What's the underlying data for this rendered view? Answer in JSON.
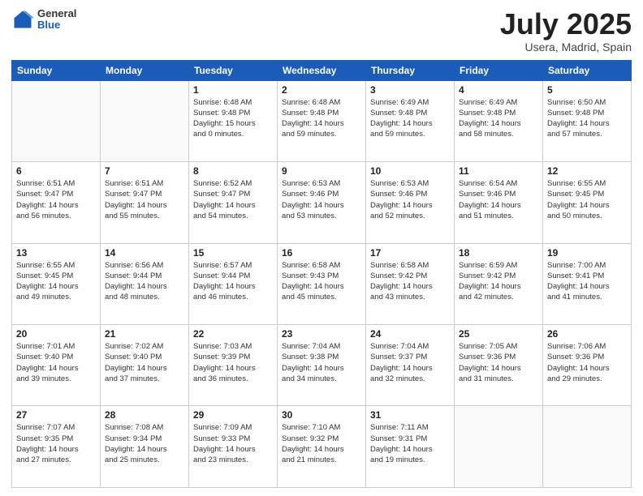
{
  "header": {
    "logo_general": "General",
    "logo_blue": "Blue",
    "month": "July 2025",
    "location": "Usera, Madrid, Spain"
  },
  "weekdays": [
    "Sunday",
    "Monday",
    "Tuesday",
    "Wednesday",
    "Thursday",
    "Friday",
    "Saturday"
  ],
  "weeks": [
    [
      {
        "day": "",
        "info": ""
      },
      {
        "day": "",
        "info": ""
      },
      {
        "day": "1",
        "info": "Sunrise: 6:48 AM\nSunset: 9:48 PM\nDaylight: 15 hours\nand 0 minutes."
      },
      {
        "day": "2",
        "info": "Sunrise: 6:48 AM\nSunset: 9:48 PM\nDaylight: 14 hours\nand 59 minutes."
      },
      {
        "day": "3",
        "info": "Sunrise: 6:49 AM\nSunset: 9:48 PM\nDaylight: 14 hours\nand 59 minutes."
      },
      {
        "day": "4",
        "info": "Sunrise: 6:49 AM\nSunset: 9:48 PM\nDaylight: 14 hours\nand 58 minutes."
      },
      {
        "day": "5",
        "info": "Sunrise: 6:50 AM\nSunset: 9:48 PM\nDaylight: 14 hours\nand 57 minutes."
      }
    ],
    [
      {
        "day": "6",
        "info": "Sunrise: 6:51 AM\nSunset: 9:47 PM\nDaylight: 14 hours\nand 56 minutes."
      },
      {
        "day": "7",
        "info": "Sunrise: 6:51 AM\nSunset: 9:47 PM\nDaylight: 14 hours\nand 55 minutes."
      },
      {
        "day": "8",
        "info": "Sunrise: 6:52 AM\nSunset: 9:47 PM\nDaylight: 14 hours\nand 54 minutes."
      },
      {
        "day": "9",
        "info": "Sunrise: 6:53 AM\nSunset: 9:46 PM\nDaylight: 14 hours\nand 53 minutes."
      },
      {
        "day": "10",
        "info": "Sunrise: 6:53 AM\nSunset: 9:46 PM\nDaylight: 14 hours\nand 52 minutes."
      },
      {
        "day": "11",
        "info": "Sunrise: 6:54 AM\nSunset: 9:46 PM\nDaylight: 14 hours\nand 51 minutes."
      },
      {
        "day": "12",
        "info": "Sunrise: 6:55 AM\nSunset: 9:45 PM\nDaylight: 14 hours\nand 50 minutes."
      }
    ],
    [
      {
        "day": "13",
        "info": "Sunrise: 6:55 AM\nSunset: 9:45 PM\nDaylight: 14 hours\nand 49 minutes."
      },
      {
        "day": "14",
        "info": "Sunrise: 6:56 AM\nSunset: 9:44 PM\nDaylight: 14 hours\nand 48 minutes."
      },
      {
        "day": "15",
        "info": "Sunrise: 6:57 AM\nSunset: 9:44 PM\nDaylight: 14 hours\nand 46 minutes."
      },
      {
        "day": "16",
        "info": "Sunrise: 6:58 AM\nSunset: 9:43 PM\nDaylight: 14 hours\nand 45 minutes."
      },
      {
        "day": "17",
        "info": "Sunrise: 6:58 AM\nSunset: 9:42 PM\nDaylight: 14 hours\nand 43 minutes."
      },
      {
        "day": "18",
        "info": "Sunrise: 6:59 AM\nSunset: 9:42 PM\nDaylight: 14 hours\nand 42 minutes."
      },
      {
        "day": "19",
        "info": "Sunrise: 7:00 AM\nSunset: 9:41 PM\nDaylight: 14 hours\nand 41 minutes."
      }
    ],
    [
      {
        "day": "20",
        "info": "Sunrise: 7:01 AM\nSunset: 9:40 PM\nDaylight: 14 hours\nand 39 minutes."
      },
      {
        "day": "21",
        "info": "Sunrise: 7:02 AM\nSunset: 9:40 PM\nDaylight: 14 hours\nand 37 minutes."
      },
      {
        "day": "22",
        "info": "Sunrise: 7:03 AM\nSunset: 9:39 PM\nDaylight: 14 hours\nand 36 minutes."
      },
      {
        "day": "23",
        "info": "Sunrise: 7:04 AM\nSunset: 9:38 PM\nDaylight: 14 hours\nand 34 minutes."
      },
      {
        "day": "24",
        "info": "Sunrise: 7:04 AM\nSunset: 9:37 PM\nDaylight: 14 hours\nand 32 minutes."
      },
      {
        "day": "25",
        "info": "Sunrise: 7:05 AM\nSunset: 9:36 PM\nDaylight: 14 hours\nand 31 minutes."
      },
      {
        "day": "26",
        "info": "Sunrise: 7:06 AM\nSunset: 9:36 PM\nDaylight: 14 hours\nand 29 minutes."
      }
    ],
    [
      {
        "day": "27",
        "info": "Sunrise: 7:07 AM\nSunset: 9:35 PM\nDaylight: 14 hours\nand 27 minutes."
      },
      {
        "day": "28",
        "info": "Sunrise: 7:08 AM\nSunset: 9:34 PM\nDaylight: 14 hours\nand 25 minutes."
      },
      {
        "day": "29",
        "info": "Sunrise: 7:09 AM\nSunset: 9:33 PM\nDaylight: 14 hours\nand 23 minutes."
      },
      {
        "day": "30",
        "info": "Sunrise: 7:10 AM\nSunset: 9:32 PM\nDaylight: 14 hours\nand 21 minutes."
      },
      {
        "day": "31",
        "info": "Sunrise: 7:11 AM\nSunset: 9:31 PM\nDaylight: 14 hours\nand 19 minutes."
      },
      {
        "day": "",
        "info": ""
      },
      {
        "day": "",
        "info": ""
      }
    ]
  ]
}
